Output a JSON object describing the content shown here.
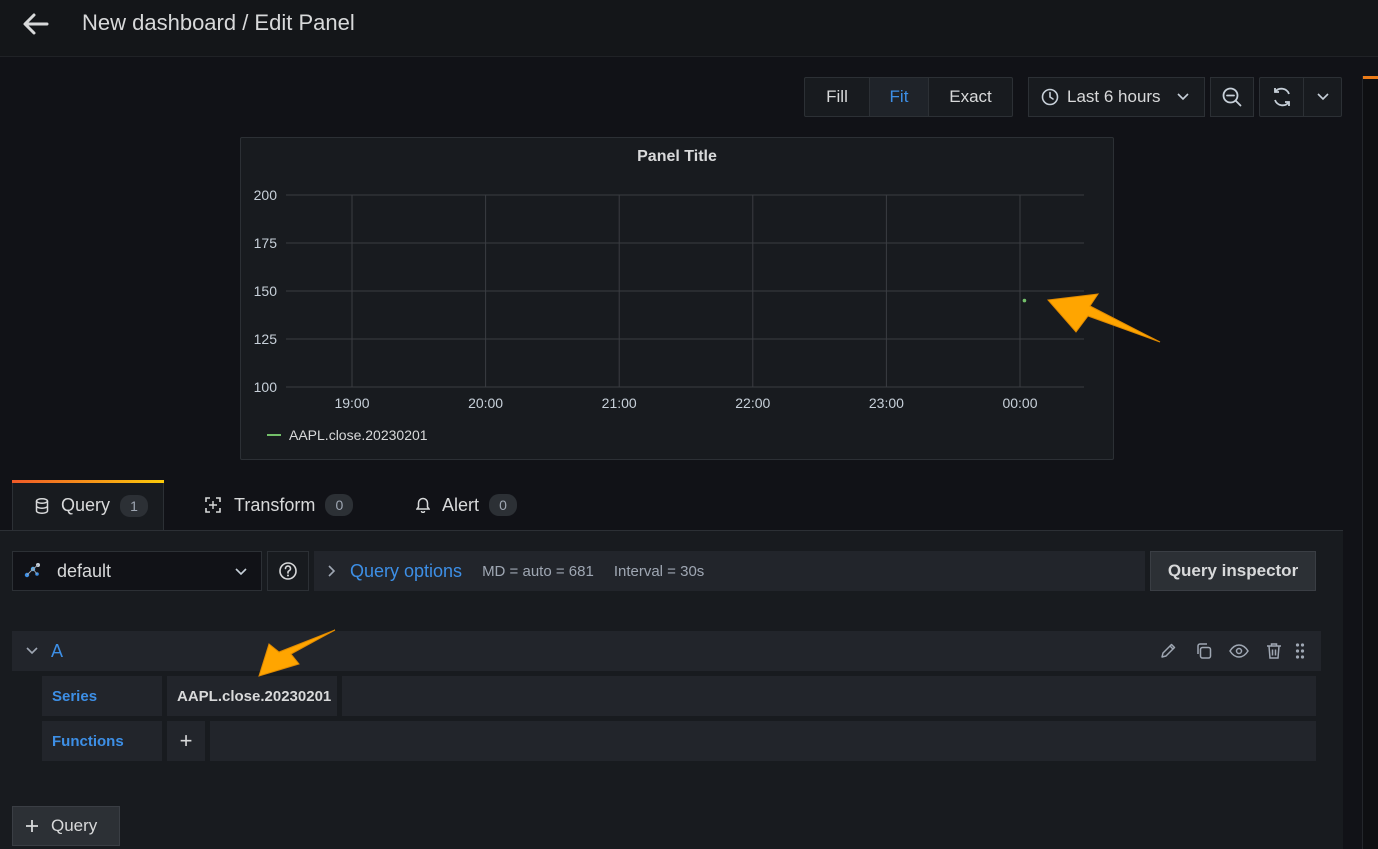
{
  "header": {
    "title": "New dashboard / Edit Panel"
  },
  "toolbar": {
    "fill_label": "Fill",
    "fit_label": "Fit",
    "exact_label": "Exact",
    "time_range_label": "Last 6 hours"
  },
  "panel": {
    "title": "Panel Title",
    "legend_series": "AAPL.close.20230201"
  },
  "chart_data": {
    "type": "line",
    "title": "Panel Title",
    "x": [
      "19:00",
      "20:00",
      "21:00",
      "22:00",
      "23:00",
      "00:00"
    ],
    "y_ticks": [
      200,
      175,
      150,
      125,
      100
    ],
    "ylim": [
      100,
      200
    ],
    "grid": true,
    "legend": "bottom-left",
    "series": [
      {
        "name": "AAPL.close.20230201",
        "color": "#73bf69",
        "points": [
          {
            "x": "00:02",
            "y": 145
          }
        ]
      }
    ]
  },
  "tabs": [
    {
      "label": "Query",
      "count": "1"
    },
    {
      "label": "Transform",
      "count": "0"
    },
    {
      "label": "Alert",
      "count": "0"
    }
  ],
  "query_bar": {
    "datasource": "default",
    "options_label": "Query options",
    "md_text": "MD = auto = 681",
    "interval_text": "Interval = 30s",
    "inspector_label": "Query inspector"
  },
  "query_row": {
    "ref_id": "A",
    "series_label": "Series",
    "series_value": "AAPL.close.20230201",
    "functions_label": "Functions",
    "add_symbol": "+"
  },
  "add_query_label": "Query",
  "colors": {
    "accent_blue": "#3d8fe6",
    "series_green": "#73bf69",
    "annotation_orange": "#ffa500"
  }
}
